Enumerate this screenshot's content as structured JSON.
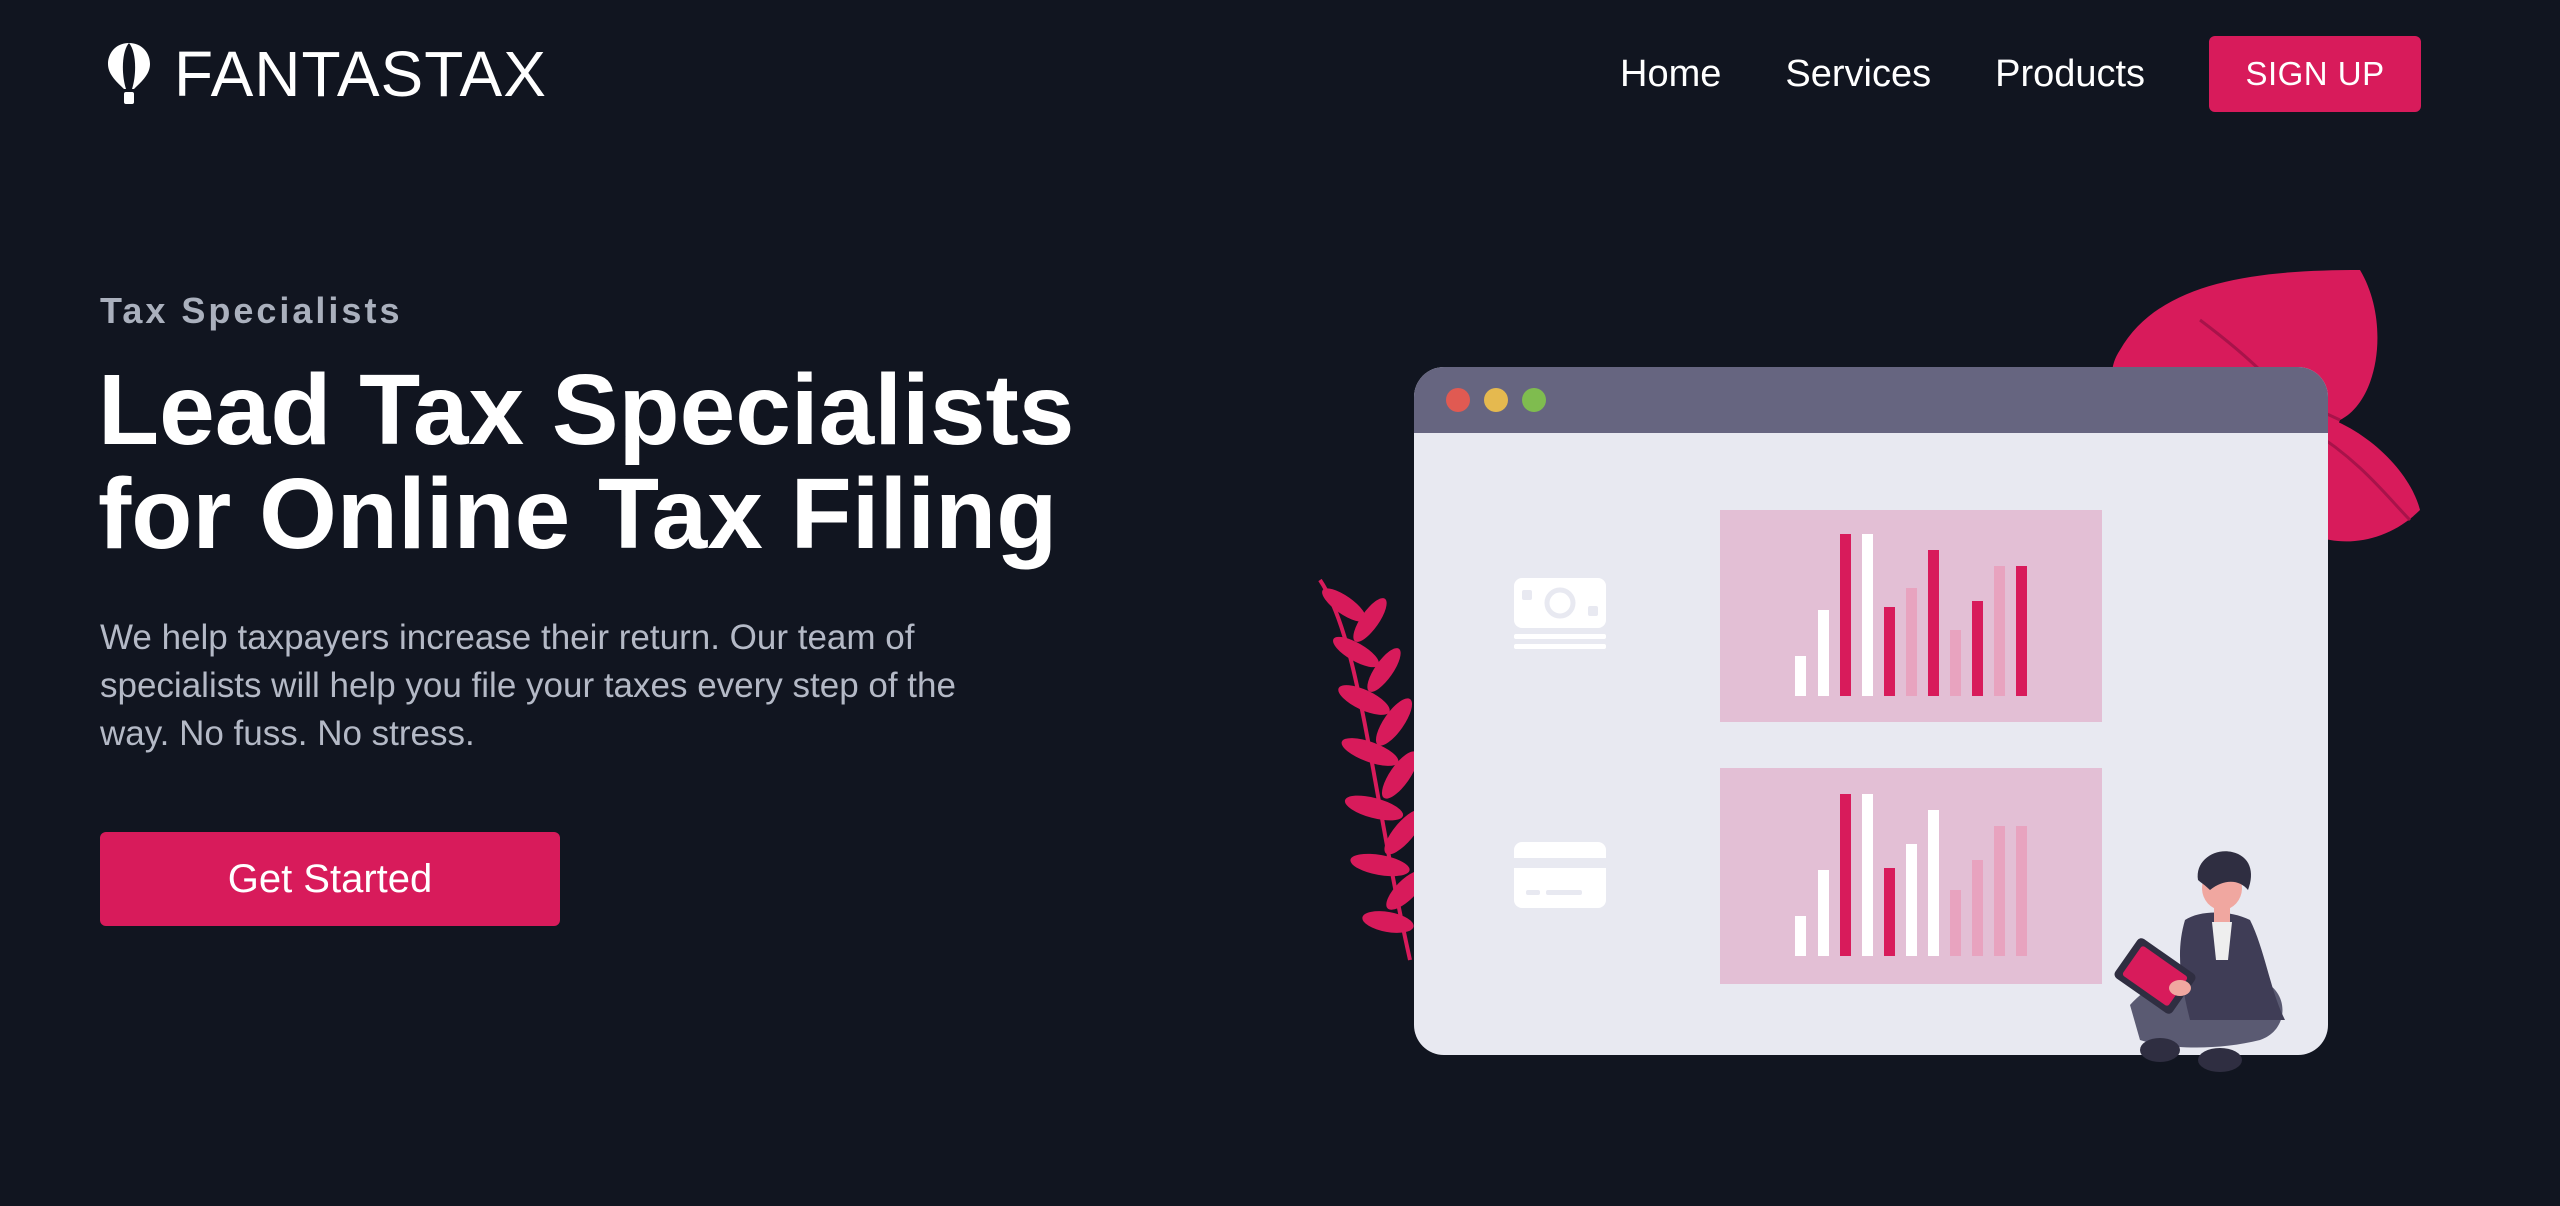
{
  "header": {
    "brand": "FANTASTAX",
    "brand_icon": "hot-air-balloon-icon",
    "nav": [
      {
        "label": "Home"
      },
      {
        "label": "Services"
      },
      {
        "label": "Products"
      }
    ],
    "signup_label": "SIGN UP"
  },
  "hero": {
    "eyebrow": "Tax Specialists",
    "headline_line1": "Lead Tax Specialists",
    "headline_line2": "for Online Tax Filing",
    "lead": "We help taxpayers increase their return. Our team of specialists will help you file your taxes every step of the way. No fuss. No stress.",
    "cta_label": "Get Started"
  },
  "illustration": {
    "icons": [
      "cash-icon",
      "credit-card-icon",
      "leaf-icon",
      "fern-icon",
      "person-with-tablet"
    ]
  },
  "colors": {
    "background": "#111520",
    "accent": "#d81b5b",
    "muted_text": "#b4b9c6",
    "window_bar": "#666580",
    "window_body": "#e8e9f1",
    "chart_panel": "#e3bfd5"
  }
}
